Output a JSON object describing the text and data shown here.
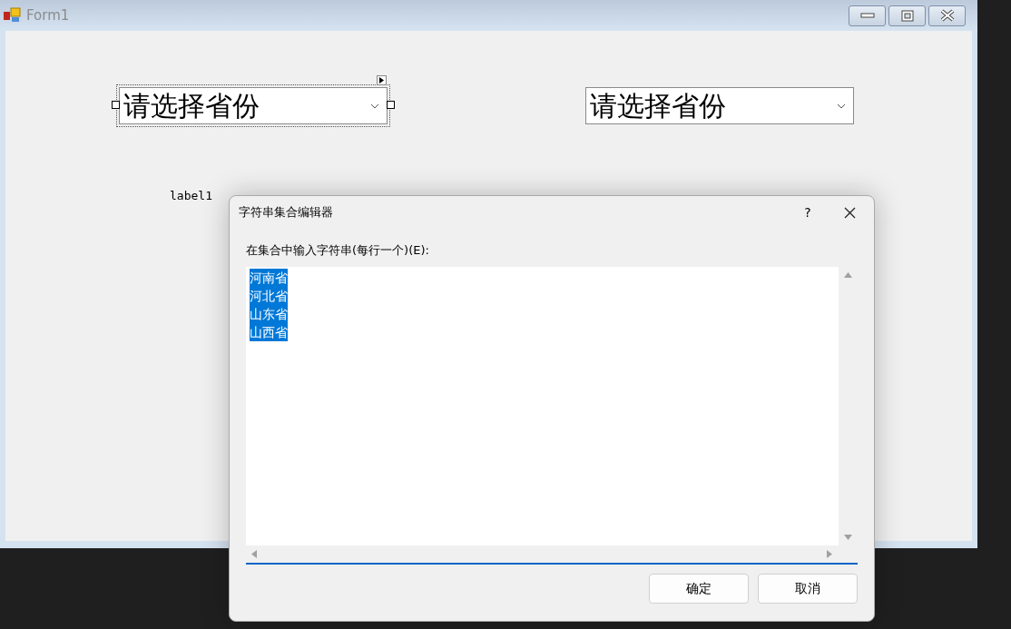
{
  "window": {
    "title": "Form1"
  },
  "form": {
    "combos": [
      {
        "text": "请选择省份",
        "selected": true
      },
      {
        "text": "请选择省份",
        "selected": false
      }
    ],
    "labels": [
      "label1"
    ]
  },
  "dialog": {
    "title": "字符串集合编辑器",
    "help": "?",
    "prompt": "在集合中输入字符串(每行一个)(E):",
    "lines": [
      {
        "text": "河南省",
        "selected": true
      },
      {
        "text": "河北省",
        "selected": true
      },
      {
        "text": "山东省",
        "selected": true
      },
      {
        "text": "山西省",
        "selected": true
      }
    ],
    "buttons": [
      "确定",
      "取消"
    ]
  }
}
